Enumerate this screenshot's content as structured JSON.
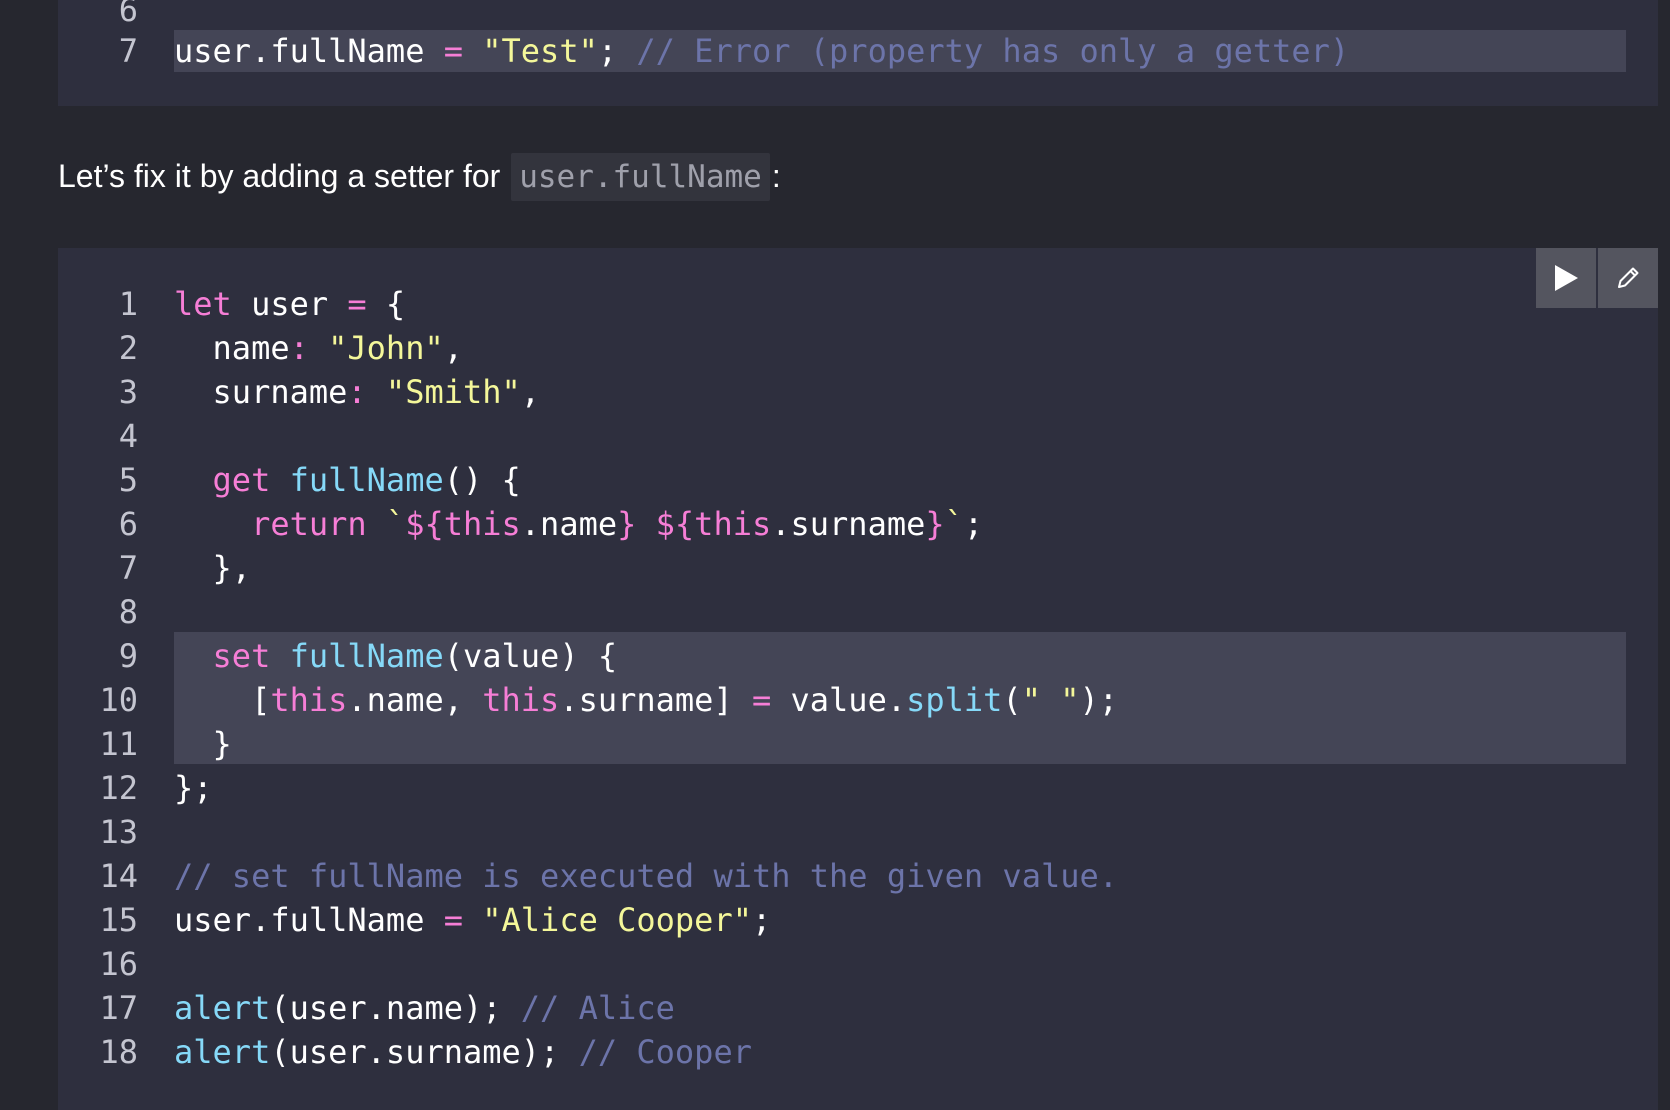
{
  "previous_block": {
    "lines": [
      {
        "num": "6",
        "tokens": []
      },
      {
        "num": "7",
        "tokens": [
          {
            "t": "user.fullName ",
            "c": ""
          },
          {
            "t": "=",
            "c": "op"
          },
          {
            "t": " ",
            "c": ""
          },
          {
            "t": "\"Test\"",
            "c": "str"
          },
          {
            "t": "; ",
            "c": ""
          },
          {
            "t": "// Error (property has only a getter)",
            "c": "cm"
          }
        ]
      }
    ]
  },
  "prose": {
    "before": "Let’s fix it by adding a setter for ",
    "inline_code": "user.fullName",
    "after": ":"
  },
  "toolbar": {
    "run_icon": "play-icon",
    "edit_icon": "pencil-icon"
  },
  "main_block": {
    "lines": [
      {
        "num": "1",
        "tokens": [
          {
            "t": "let",
            "c": "kw"
          },
          {
            "t": " user ",
            "c": ""
          },
          {
            "t": "=",
            "c": "op"
          },
          {
            "t": " {",
            "c": ""
          }
        ]
      },
      {
        "num": "2",
        "tokens": [
          {
            "t": "  name",
            "c": ""
          },
          {
            "t": ":",
            "c": "op"
          },
          {
            "t": " ",
            "c": ""
          },
          {
            "t": "\"John\"",
            "c": "str"
          },
          {
            "t": ",",
            "c": ""
          }
        ]
      },
      {
        "num": "3",
        "tokens": [
          {
            "t": "  surname",
            "c": ""
          },
          {
            "t": ":",
            "c": "op"
          },
          {
            "t": " ",
            "c": ""
          },
          {
            "t": "\"Smith\"",
            "c": "str"
          },
          {
            "t": ",",
            "c": ""
          }
        ]
      },
      {
        "num": "4",
        "tokens": []
      },
      {
        "num": "5",
        "tokens": [
          {
            "t": "  ",
            "c": ""
          },
          {
            "t": "get",
            "c": "kw"
          },
          {
            "t": " ",
            "c": ""
          },
          {
            "t": "fullName",
            "c": "fn"
          },
          {
            "t": "() {",
            "c": ""
          }
        ]
      },
      {
        "num": "6",
        "tokens": [
          {
            "t": "    ",
            "c": ""
          },
          {
            "t": "return",
            "c": "kw"
          },
          {
            "t": " ",
            "c": ""
          },
          {
            "t": "`",
            "c": "str"
          },
          {
            "t": "${",
            "c": "kw"
          },
          {
            "t": "this",
            "c": "kw"
          },
          {
            "t": ".name",
            "c": ""
          },
          {
            "t": "}",
            "c": "kw"
          },
          {
            "t": " ",
            "c": "str"
          },
          {
            "t": "${",
            "c": "kw"
          },
          {
            "t": "this",
            "c": "kw"
          },
          {
            "t": ".surname",
            "c": ""
          },
          {
            "t": "}",
            "c": "kw"
          },
          {
            "t": "`",
            "c": "str"
          },
          {
            "t": ";",
            "c": ""
          }
        ]
      },
      {
        "num": "7",
        "tokens": [
          {
            "t": "  },",
            "c": ""
          }
        ]
      },
      {
        "num": "8",
        "tokens": []
      },
      {
        "num": "9",
        "tokens": [
          {
            "t": "  ",
            "c": ""
          },
          {
            "t": "set",
            "c": "kw"
          },
          {
            "t": " ",
            "c": ""
          },
          {
            "t": "fullName",
            "c": "fn"
          },
          {
            "t": "(value) {",
            "c": ""
          }
        ]
      },
      {
        "num": "10",
        "tokens": [
          {
            "t": "    [",
            "c": ""
          },
          {
            "t": "this",
            "c": "kw"
          },
          {
            "t": ".name, ",
            "c": ""
          },
          {
            "t": "this",
            "c": "kw"
          },
          {
            "t": ".surname] ",
            "c": ""
          },
          {
            "t": "=",
            "c": "op"
          },
          {
            "t": " value.",
            "c": ""
          },
          {
            "t": "split",
            "c": "fn"
          },
          {
            "t": "(",
            "c": ""
          },
          {
            "t": "\" \"",
            "c": "str"
          },
          {
            "t": ");",
            "c": ""
          }
        ]
      },
      {
        "num": "11",
        "tokens": [
          {
            "t": "  }",
            "c": ""
          }
        ]
      },
      {
        "num": "12",
        "tokens": [
          {
            "t": "};",
            "c": ""
          }
        ]
      },
      {
        "num": "13",
        "tokens": []
      },
      {
        "num": "14",
        "tokens": [
          {
            "t": "// set fullName is executed with the given value.",
            "c": "cm"
          }
        ]
      },
      {
        "num": "15",
        "tokens": [
          {
            "t": "user.fullName ",
            "c": ""
          },
          {
            "t": "=",
            "c": "op"
          },
          {
            "t": " ",
            "c": ""
          },
          {
            "t": "\"Alice Cooper\"",
            "c": "str"
          },
          {
            "t": ";",
            "c": ""
          }
        ]
      },
      {
        "num": "16",
        "tokens": []
      },
      {
        "num": "17",
        "tokens": [
          {
            "t": "alert",
            "c": "fn"
          },
          {
            "t": "(user.name); ",
            "c": ""
          },
          {
            "t": "// Alice",
            "c": "cm"
          }
        ]
      },
      {
        "num": "18",
        "tokens": [
          {
            "t": "alert",
            "c": "fn"
          },
          {
            "t": "(user.surname); ",
            "c": ""
          },
          {
            "t": "// Cooper",
            "c": "cm"
          }
        ]
      }
    ]
  },
  "colors": {
    "page_bg": "#26272f",
    "code_bg": "#2e2f3e",
    "highlight_bg": "#444556",
    "keyword": "#f67ed6",
    "function": "#86d9f8",
    "string": "#f4f79a",
    "comment": "#6c74a9"
  }
}
